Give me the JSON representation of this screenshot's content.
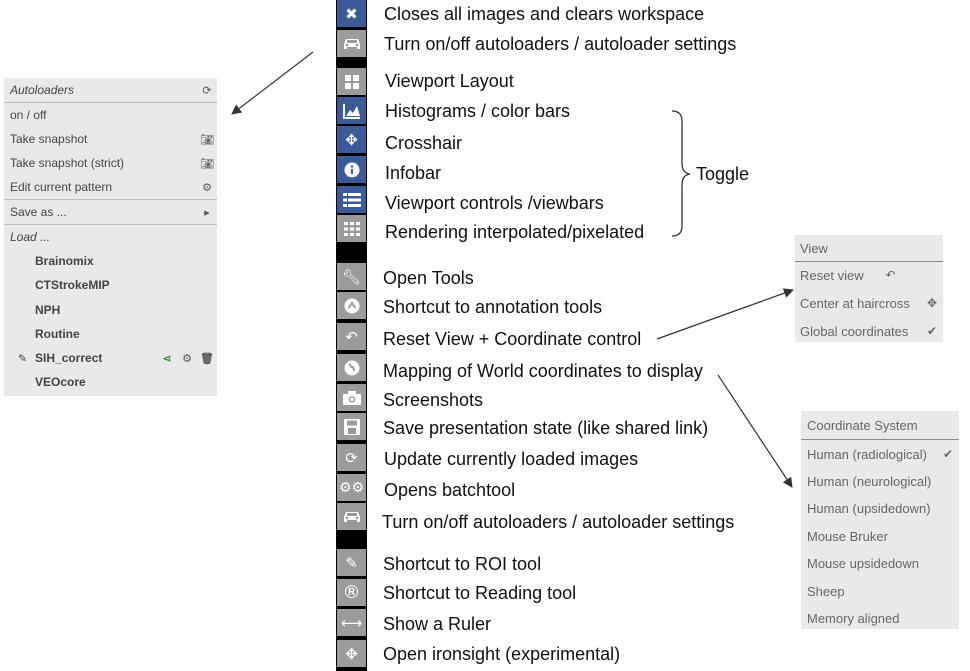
{
  "toolbar": {
    "descriptions": [
      "Closes all images and clears workspace",
      "Turn on/off autoloaders / autoloader settings",
      "Viewport Layout",
      "Histograms / color bars",
      "Crosshair",
      "Infobar",
      "Viewport controls /viewbars",
      "Rendering interpolated/pixelated",
      "Open Tools",
      "Shortcut to annotation tools",
      "Reset View + Coordinate control",
      "Mapping of World coordinates to display",
      "Screenshots",
      "Save presentation state (like shared link)",
      "Update currently loaded images",
      "Opens batchtool",
      "Turn on/off autoloaders / autoloader settings",
      "Shortcut to ROI tool",
      "Shortcut to Reading tool",
      "Show a Ruler",
      "Open ironsight (experimental)"
    ],
    "toggle_label": "Toggle"
  },
  "autoloaders": {
    "title": "Autoloaders",
    "on_off": "on / off",
    "take_snapshot": "Take snapshot",
    "take_snapshot_strict": "Take snapshot (strict)",
    "edit_pattern": "Edit current pattern",
    "save_as": "Save as ...",
    "load": "Load ...",
    "items": [
      "Brainomix",
      "CTStrokeMIP",
      "NPH",
      "Routine",
      "SIH_correct",
      "VEOcore"
    ]
  },
  "view_panel": {
    "title": "View",
    "reset_view": "Reset view",
    "center_haircross": "Center at haircross",
    "global_coordinates": "Global coordinates"
  },
  "coord_panel": {
    "title": "Coordinate System",
    "options": [
      "Human (radiological)",
      "Human (neurological)",
      "Human (upsidedown)",
      "Mouse Bruker",
      "Mouse upsidedown",
      "Sheep",
      "Memory aligned"
    ],
    "selected": "Human (radiological)"
  },
  "colors": {
    "toolbar_blue": "#3a5a98",
    "toolbar_grey": "#9b9b9b",
    "panel_bg": "#e9e9e9",
    "share_green": "#2e8b2e"
  }
}
